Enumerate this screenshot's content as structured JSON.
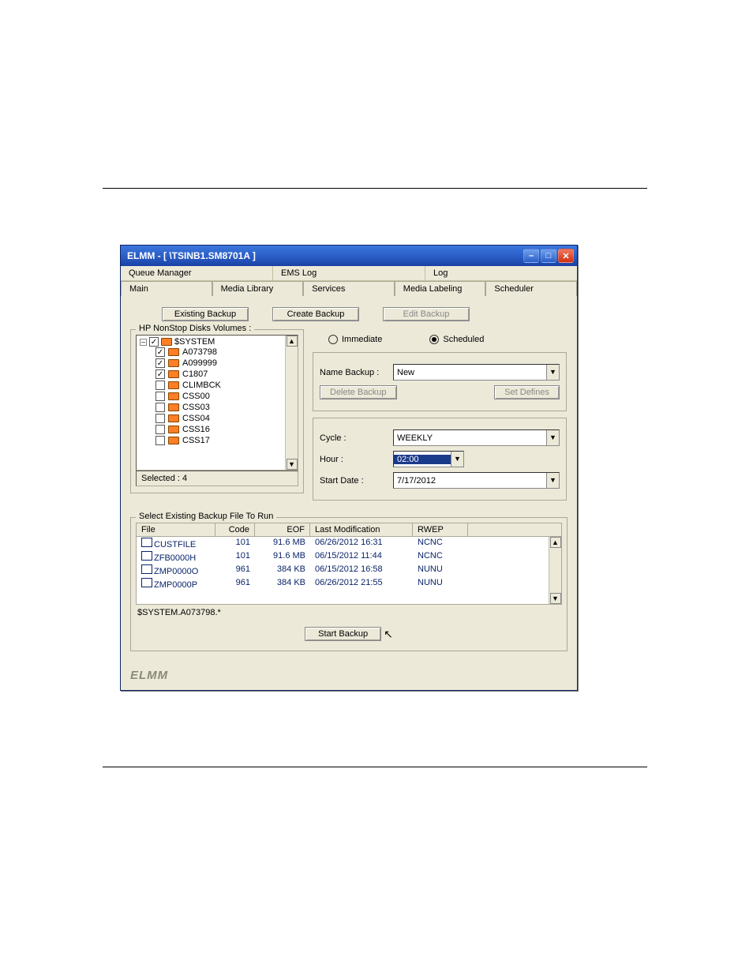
{
  "misc": {
    "top_link": " ",
    "cursor_glyph": "↖"
  },
  "window": {
    "title": "ELMM - [ \\TSINB1.SM8701A ]",
    "controls": {
      "min": "–",
      "max": "□",
      "close": "✕"
    },
    "menurow": [
      "Queue Manager",
      "EMS Log",
      "Log"
    ],
    "tabs": [
      "Main",
      "Media Library",
      "Services",
      "Media Labeling",
      "Scheduler"
    ],
    "brand": "ELMM"
  },
  "buttons": {
    "existing": "Existing Backup",
    "create": "Create Backup",
    "edit": "Edit Backup",
    "delete": "Delete Backup",
    "setdefines": "Set Defines",
    "start": "Start Backup"
  },
  "tree": {
    "legend": "HP NonStop Disks Volumes :",
    "root": "$SYSTEM",
    "root_checked": true,
    "expander": "–",
    "nodes": [
      {
        "label": "A073798",
        "checked": true
      },
      {
        "label": "A099999",
        "checked": true
      },
      {
        "label": "C1807",
        "checked": true
      },
      {
        "label": "CLIMBCK",
        "checked": false
      },
      {
        "label": "CSS00",
        "checked": false
      },
      {
        "label": "CSS03",
        "checked": false
      },
      {
        "label": "CSS04",
        "checked": false
      },
      {
        "label": "CSS16",
        "checked": false
      },
      {
        "label": "CSS17",
        "checked": false
      }
    ],
    "selected_label": "Selected :",
    "selected_count": "4"
  },
  "sched": {
    "radio_immediate": "Immediate",
    "radio_scheduled": "Scheduled",
    "selected": "Scheduled",
    "name_label": "Name Backup :",
    "name_value": "New",
    "cycle_label": "Cycle :",
    "cycle_value": "WEEKLY",
    "hour_label": "Hour :",
    "hour_value": "02:00",
    "startdate_label": "Start Date :",
    "startdate_value": "7/17/2012"
  },
  "files": {
    "legend": "Select Existing Backup File To Run",
    "headers": {
      "file": "File",
      "code": "Code",
      "eof": "EOF",
      "mod": "Last Modification",
      "rwep": "RWEP"
    },
    "rows": [
      {
        "file": "CUSTFILE",
        "code": "101",
        "eof": "91.6 MB",
        "mod": "06/26/2012 16:31",
        "rwep": "NCNC"
      },
      {
        "file": "ZFB0000H",
        "code": "101",
        "eof": "91.6 MB",
        "mod": "06/15/2012 11:44",
        "rwep": "NCNC"
      },
      {
        "file": "ZMP0000O",
        "code": "961",
        "eof": "384 KB",
        "mod": "06/15/2012 16:58",
        "rwep": "NUNU"
      },
      {
        "file": "ZMP0000P",
        "code": "961",
        "eof": "384 KB",
        "mod": "06/26/2012 21:55",
        "rwep": "NUNU"
      }
    ],
    "path": "$SYSTEM.A073798.*"
  },
  "glyphs": {
    "up": "▲",
    "down": "▼",
    "check": "✓",
    "dd": "▼"
  }
}
